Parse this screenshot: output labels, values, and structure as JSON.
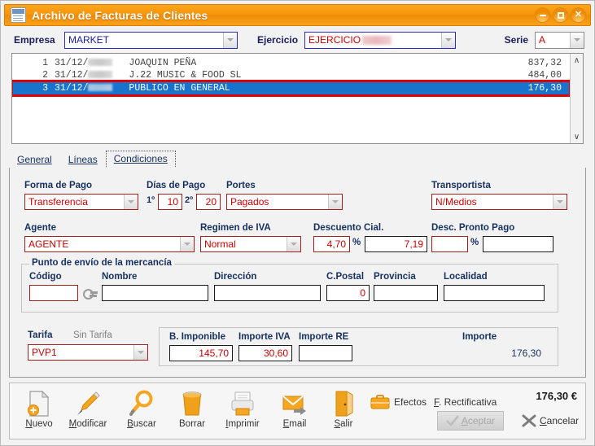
{
  "window": {
    "title": "Archivo de Facturas de Clientes",
    "icon": "invoice-archive-icon",
    "buttons": {
      "minimize": "–",
      "maximize": "❐",
      "close": "✕"
    }
  },
  "header": {
    "empresa_label": "Empresa",
    "empresa_value": "MARKET",
    "ejercicio_label": "Ejercicio",
    "ejercicio_value": "EJERCICIO",
    "ejercicio_redacted": true,
    "serie_label": "Serie",
    "serie_value": "A"
  },
  "list": {
    "rows": [
      {
        "num": "1",
        "date": "31/12/",
        "name": "JOAQUIN PEÑA",
        "amount": "837,32",
        "selected": false
      },
      {
        "num": "2",
        "date": "31/12/",
        "name": "J.22 MUSIC & FOOD SL",
        "amount": "484,00",
        "selected": false
      },
      {
        "num": "3",
        "date": "31/12/",
        "name": "PUBLICO EN GENERAL",
        "amount": "176,30",
        "selected": true
      }
    ],
    "scroll_up": "∧",
    "scroll_down": "∨"
  },
  "tabs": [
    {
      "id": "general",
      "label": "General",
      "active": false
    },
    {
      "id": "lineas",
      "label": "Líneas",
      "active": false
    },
    {
      "id": "condiciones",
      "label": "Condiciones",
      "active": true
    }
  ],
  "condiciones": {
    "forma_de_pago": {
      "label": "Forma de Pago",
      "value": "Transferencia"
    },
    "dias_de_pago": {
      "label": "Días de Pago",
      "first_mark": "1º",
      "first": "10",
      "second_mark": "2º",
      "second": "20"
    },
    "portes": {
      "label": "Portes",
      "value": "Pagados"
    },
    "transportista": {
      "label": "Transportista",
      "value": "N/Medios"
    },
    "agente": {
      "label": "Agente",
      "value": "AGENTE"
    },
    "regimen_iva": {
      "label": "Regimen de IVA",
      "value": "Normal"
    },
    "descuento_cial": {
      "label": "Descuento Cial.",
      "percent": "4,70",
      "pct_sign": "%",
      "amount": "7,19"
    },
    "desc_pronto_pago": {
      "label": "Desc. Pronto Pago",
      "percent": "",
      "pct_sign": "%",
      "amount": ""
    },
    "punto_envio": {
      "title": "Punto de envío de la mercancía",
      "codigo_label": "Código",
      "codigo_value": "",
      "search_icon": "key-icon",
      "nombre_label": "Nombre",
      "nombre_value": "",
      "direccion_label": "Dirección",
      "direccion_value": "",
      "cpostal_label": "C.Postal",
      "cpostal_value": "0",
      "provincia_label": "Provincia",
      "provincia_value": "",
      "localidad_label": "Localidad",
      "localidad_value": ""
    },
    "tarifa": {
      "label": "Tarifa",
      "note": "Sin Tarifa",
      "value": "PVP1"
    },
    "totals": {
      "base_imponible_label": "B. Imponible",
      "base_imponible_value": "145,70",
      "importe_iva_label": "Importe IVA",
      "importe_iva_value": "30,60",
      "importe_re_label": "Importe RE",
      "importe_re_value": "",
      "importe_label": "Importe",
      "importe_value": "176,30"
    }
  },
  "toolbar": {
    "buttons": [
      {
        "id": "nuevo",
        "label": "Nuevo",
        "accel": "N",
        "icon": "new-document-icon"
      },
      {
        "id": "modificar",
        "label": "Modificar",
        "accel": "M",
        "icon": "pen-edit-icon"
      },
      {
        "id": "buscar",
        "label": "Buscar",
        "accel": "B",
        "icon": "magnifier-icon"
      },
      {
        "id": "borrar",
        "label": "Borrar",
        "accel": "",
        "icon": "trash-bin-icon"
      },
      {
        "id": "imprimir",
        "label": "Imprimir",
        "accel": "I",
        "icon": "printer-icon"
      },
      {
        "id": "email",
        "label": "Email",
        "accel": "E",
        "icon": "envelope-send-icon"
      },
      {
        "id": "salir",
        "label": "Salir",
        "accel": "S",
        "icon": "exit-door-icon"
      }
    ],
    "efectos_label": "Efectos",
    "efectos_icon": "briefcase-icon",
    "rectificativa_label": "F. Rectificativa",
    "rectificativa_accel": "F",
    "total_label": "176,30 €",
    "accept_label": "Aceptar",
    "accept_accel": "A",
    "accept_icon": "check-icon",
    "accept_disabled": true,
    "cancel_label": "Cancelar",
    "cancel_accel": "C",
    "cancel_icon": "x-cross-icon"
  },
  "colors": {
    "titlebar": "#f79408",
    "selection": "#1873cd",
    "selection_outline": "#e00000",
    "field_border_red": "#a02020",
    "value_red": "#cc0000",
    "label_blue": "#16305e"
  }
}
